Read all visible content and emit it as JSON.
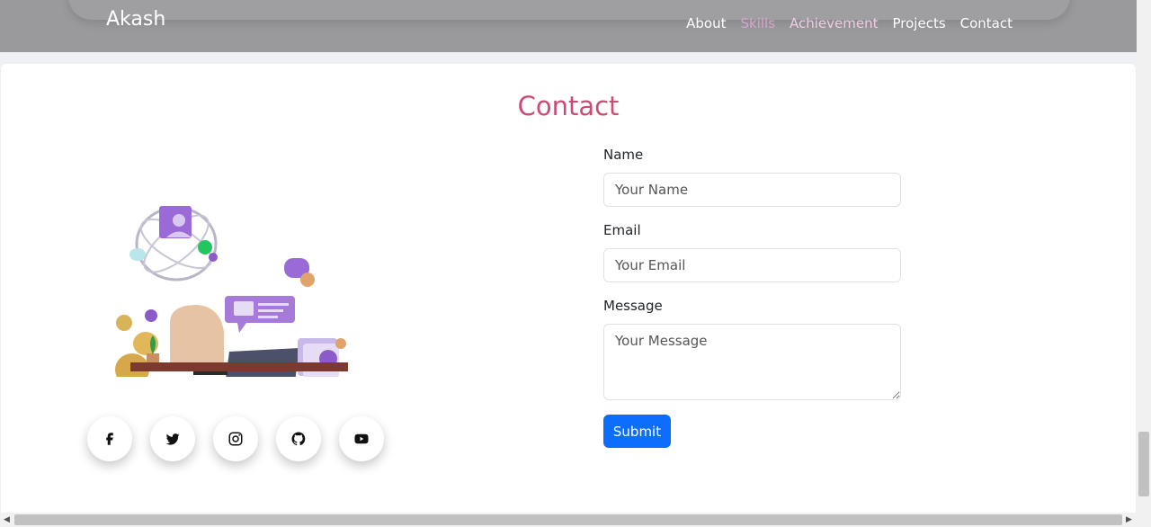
{
  "nav": {
    "brand": "Akash",
    "links": [
      "About",
      "Skills",
      "Achievement",
      "Projects",
      "Contact"
    ]
  },
  "contact": {
    "title": "Contact",
    "form": {
      "name_label": "Name",
      "name_placeholder": "Your Name",
      "email_label": "Email",
      "email_placeholder": "Your Email",
      "message_label": "Message",
      "message_placeholder": "Your Message",
      "submit_label": "Submit"
    },
    "socials": [
      "facebook-icon",
      "twitter-icon",
      "instagram-icon",
      "github-icon",
      "youtube-icon"
    ]
  },
  "colors": {
    "accent": "#0d6efd",
    "title_gradient_start": "#b63faf",
    "title_gradient_end": "#e0553c",
    "nav_active": "#d9a3cf"
  }
}
